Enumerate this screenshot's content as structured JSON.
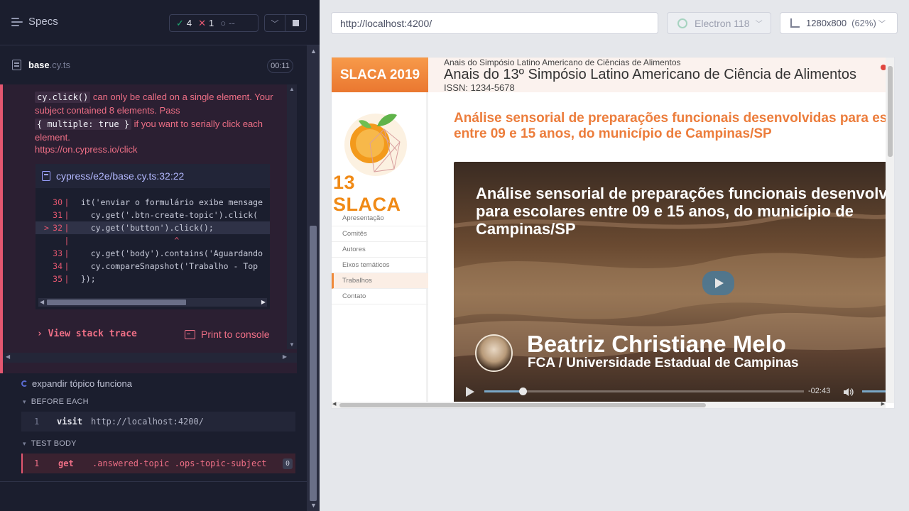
{
  "reporter": {
    "title": "Specs",
    "stats": {
      "passed": "4",
      "failed": "1",
      "pending": "--"
    },
    "spec_file": {
      "name": "base",
      "ext": ".cy.ts",
      "duration": "00:11"
    },
    "error": {
      "chip1": "cy.click()",
      "text1": " can only be called on a single element. Your subject contained 8 elements. Pass ",
      "chip2": "{ multiple: true }",
      "text2": " if you want to serially click each element.",
      "link": "https://on.cypress.io/click",
      "code_path": "cypress/e2e/base.cy.ts:32:22",
      "code_lines": [
        {
          "num": "30",
          "code": "  it('enviar o formulário exibe mensage"
        },
        {
          "num": "31",
          "code": "    cy.get('.btn-create-topic').click("
        },
        {
          "num": "32",
          "code": "    cy.get('button').click();"
        },
        {
          "num": "",
          "code": "                     ^"
        },
        {
          "num": "33",
          "code": "    cy.get('body').contains('Aguardando"
        },
        {
          "num": "34",
          "code": "    cy.compareSnapshot('Trabalho - Top"
        },
        {
          "num": "35",
          "code": "  });"
        }
      ],
      "view_stack": "View stack trace",
      "print_console": "Print to console"
    },
    "test2": "expandir tópico funciona",
    "before_each": {
      "title": "BEFORE EACH",
      "commands": [
        {
          "index": "1",
          "name": "visit",
          "arg": "http://localhost:4200/"
        }
      ]
    },
    "test_body": {
      "title": "TEST BODY",
      "commands": [
        {
          "index": "1",
          "name": "get",
          "arg": ".answered-topic .ops-topic-subject",
          "count": "0"
        }
      ]
    }
  },
  "toolbar": {
    "url": "http://localhost:4200/",
    "browser": "Electron 118",
    "viewport": "1280x800",
    "viewport_pct": "(62%)"
  },
  "site": {
    "logo": "SLACA 2019",
    "supertitle": "Anais do Simpósio Latino Americano de Ciências de Alimentos",
    "title": "Anais do 13º Simpósio Latino Americano de Ciência de Alimentos",
    "issn": "ISSN: 1234-5678",
    "logo_text": "13 SLACA",
    "nav": [
      "Apresentação",
      "Comitês",
      "Autores",
      "Eixos temáticos",
      "Trabalhos",
      "Contato"
    ],
    "nav_active": 4,
    "article_title_1": "Análise sensorial de preparações funcionais desenvolvidas para escolares",
    "article_title_2": "entre 09 e 15 anos, do município de Campinas/SP",
    "video": {
      "title_1": "Análise sensorial de preparações funcionais desenvolvidas",
      "title_2": "para escolares entre 09 e 15 anos, do município de",
      "title_3": "Campinas/SP",
      "speaker": "Beatriz Christiane Melo",
      "affiliation": "FCA / Universidade Estadual de Campinas",
      "time": "-02:43",
      "progress": 0.12
    }
  },
  "colors": {
    "accent_fail": "#e45770",
    "accent_pass": "#1fa971",
    "site_orange": "#ec7d3c"
  }
}
